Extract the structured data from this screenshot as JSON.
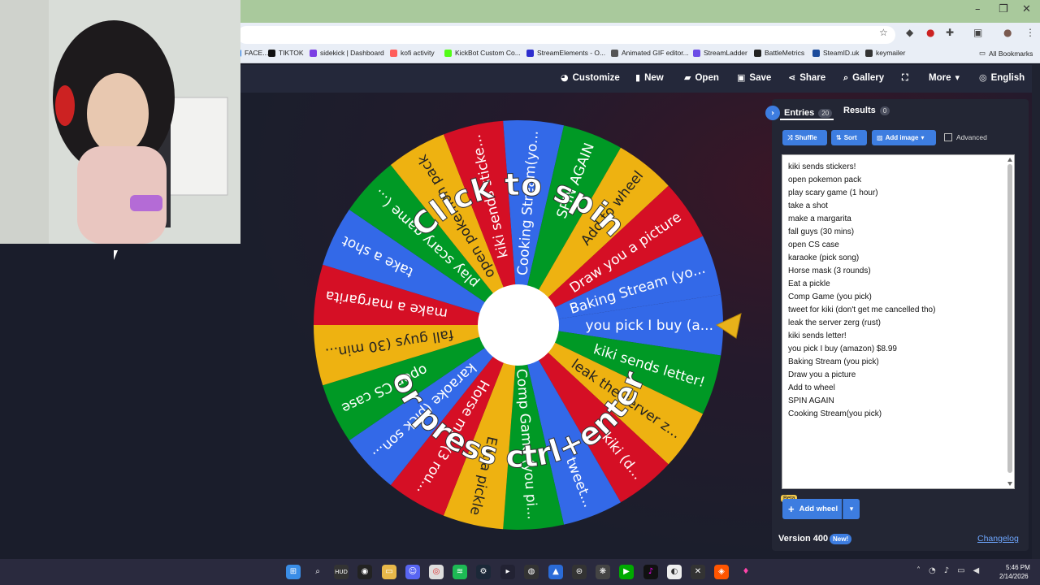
{
  "browser": {
    "bookmarks": [
      {
        "label": "FACE...",
        "color": "#1877f2"
      },
      {
        "label": "TIKTOK",
        "color": "#111111"
      },
      {
        "label": "sidekick | Dashboard",
        "color": "#7b3fe4"
      },
      {
        "label": "kofi activity",
        "color": "#ff5e5b"
      },
      {
        "label": "KickBot Custom Co...",
        "color": "#53fc18"
      },
      {
        "label": "StreamElements - O...",
        "color": "#2d2dce"
      },
      {
        "label": "Animated GIF editor...",
        "color": "#555555"
      },
      {
        "label": "StreamLadder",
        "color": "#6b4ce6"
      },
      {
        "label": "BattleMetrics",
        "color": "#222222"
      },
      {
        "label": "SteamID.uk",
        "color": "#1b4b9b"
      },
      {
        "label": "keymailer",
        "color": "#333333"
      }
    ],
    "all_bookmarks": "All Bookmarks"
  },
  "nav": {
    "customize": "Customize",
    "new": "New",
    "open": "Open",
    "save": "Save",
    "share": "Share",
    "gallery": "Gallery",
    "more": "More",
    "language": "English"
  },
  "wheel": {
    "top_text": "Click to spin",
    "bottom_text": "or press ctrl+enter",
    "segment_colors": [
      "#3369e8",
      "#009925",
      "#eeb211",
      "#d50f25"
    ],
    "slices": [
      "you pick I buy (a...",
      "kiki sends letter!",
      "leak the server z...",
      "kiki (d...",
      "tweet...",
      "Comp Game (you pi...",
      "Eat a pickle",
      "Horse m... (3 rou...",
      "karaoke (pick son...",
      "open CS case",
      "fall guys (30 min...",
      "make a margarita",
      "take a shot",
      "play scary game (...",
      "open pokemon pack",
      "kiki sends sticke...",
      "Cooking Stream(yo...",
      "SPIN AGAIN",
      "Add to wheel",
      "Draw you a picture",
      "Baking Stream (yo..."
    ]
  },
  "panel": {
    "entries_tab": "Entries",
    "entries_count": "20",
    "results_tab": "Results",
    "results_count": "0",
    "shuffle": "Shuffle",
    "sort": "Sort",
    "add_image": "Add image",
    "advanced": "Advanced",
    "entries": [
      "kiki sends stickers!",
      "open pokemon pack",
      "play scary game (1 hour)",
      "take a shot",
      "make a margarita",
      "fall guys (30 mins)",
      "open CS case",
      "karaoke (pick song)",
      "Horse mask (3 rounds)",
      "Eat a pickle",
      "Comp Game (you pick)",
      "tweet for kiki (don't get me cancelled tho)",
      "leak the server zerg (rust)",
      "kiki sends letter!",
      "you pick I buy (amazon) $8.99",
      "Baking Stream (you pick)",
      "Draw you a picture",
      "Add to wheel",
      "SPIN AGAIN",
      "Cooking Stream(you pick)"
    ],
    "beta": "Beta",
    "add_wheel": "Add wheel",
    "version": "Version 400",
    "new_badge": "New!",
    "changelog": "Changelog"
  },
  "taskbar": {
    "time": "5:46 PM",
    "date": "2/14/2026"
  }
}
